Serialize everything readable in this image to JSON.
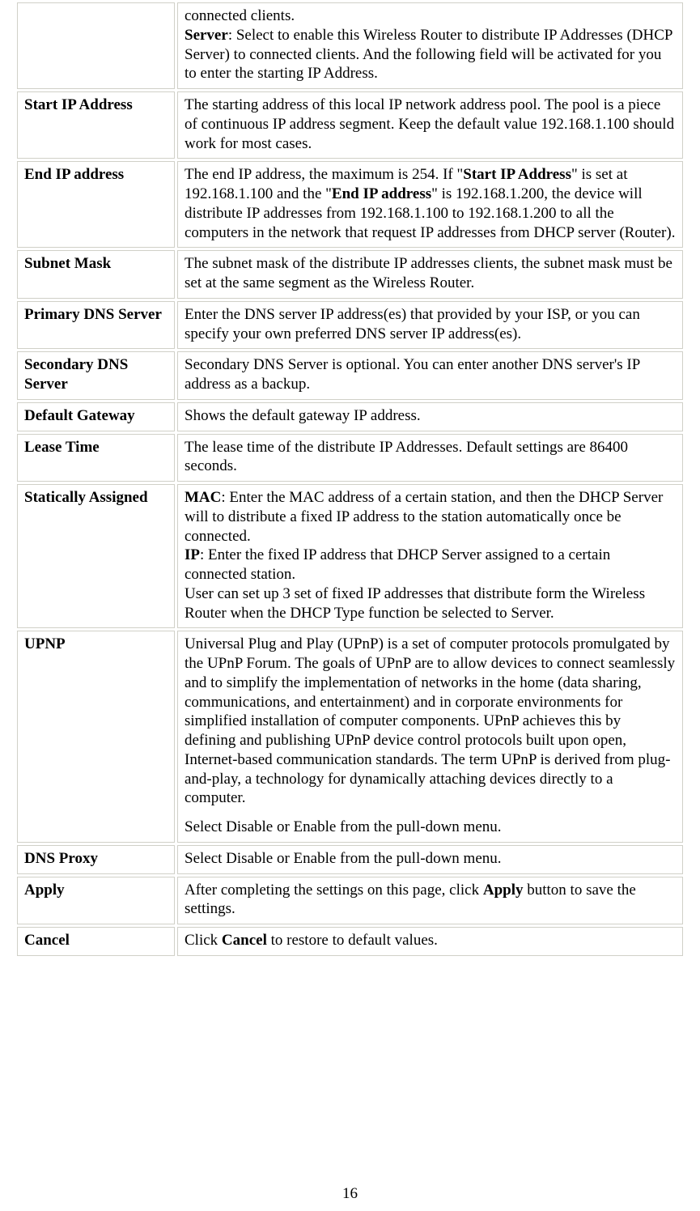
{
  "rows": [
    {
      "label": "",
      "paragraphs": [
        "connected clients.<br><span class=\"b\">Server</span>: Select to enable this Wireless  Router to distribute IP Addresses (DHCP Server) to connected clients. And the following field will be activated for you to enter the starting IP Address."
      ]
    },
    {
      "label": "Start IP Address",
      "paragraphs": [
        "The starting address of this local IP network address pool. The pool is a piece of continuous IP address segment. Keep the default value 192.168.1.100 should work for most cases."
      ]
    },
    {
      "label": "End IP address",
      "paragraphs": [
        "The end IP address, the maximum is 254. If \"<span class=\"b\">Start IP Address</span>\" is set at 192.168.1.100 and the \"<span class=\"b\">End IP address</span>\" is 192.168.1.200, the device will distribute IP addresses from 192.168.1.100 to 192.168.1.200 to all the computers in the network that request IP addresses from DHCP server (Router)."
      ]
    },
    {
      "label": "Subnet Mask",
      "paragraphs": [
        "The subnet mask of the distribute IP addresses clients, the subnet mask must be set at the same segment as the Wireless  Router."
      ]
    },
    {
      "label": "Primary DNS Server",
      "paragraphs": [
        "Enter the DNS server IP address(es) that provided by your ISP, or you can specify your own preferred DNS server IP address(es)."
      ]
    },
    {
      "label": "Secondary DNS Server",
      "paragraphs": [
        "Secondary DNS Server is optional. You can enter another DNS server's IP address as a backup."
      ]
    },
    {
      "label": "Default Gateway",
      "paragraphs": [
        "Shows the default gateway IP address."
      ]
    },
    {
      "label": "Lease Time",
      "paragraphs": [
        "The lease time of the distribute IP Addresses. Default settings are 86400 seconds."
      ]
    },
    {
      "label": "Statically Assigned",
      "paragraphs": [
        "<span class=\"b\">MAC</span>: Enter the MAC address of a certain station, and then the DHCP Server will to distribute a fixed IP address to the station automatically once be connected.<br><span class=\"b\">IP</span>: Enter the fixed IP address that DHCP Server assigned to a certain connected station.<br>User can set up 3 set of fixed IP addresses that distribute form the Wireless Router when the DHCP Type function be selected to Server."
      ]
    },
    {
      "label": "UPNP",
      "paragraphs": [
        "Universal Plug and Play (UPnP) is a set of computer protocols promulgated by the UPnP Forum. The goals of UPnP are to allow devices to connect seamlessly and to simplify the implementation of networks in the home (data sharing, communications, and entertainment) and in corporate environments for simplified installation of computer components. UPnP achieves this by defining and publishing UPnP device control protocols built upon open, Internet-based communication standards. The term UPnP is derived from plug-and-play, a technology for dynamically attaching devices directly to a computer.",
        "Select Disable or Enable from the pull-down menu."
      ]
    },
    {
      "label": "DNS Proxy",
      "paragraphs": [
        "Select Disable or Enable from the pull-down menu."
      ]
    },
    {
      "label": "Apply",
      "paragraphs": [
        "After completing the settings on this page, click <span class=\"b\">Apply</span> button to save the settings."
      ]
    },
    {
      "label": "Cancel",
      "paragraphs": [
        "Click <span class=\"b\">Cancel</span> to restore to default values."
      ]
    }
  ],
  "pageNumber": "16"
}
